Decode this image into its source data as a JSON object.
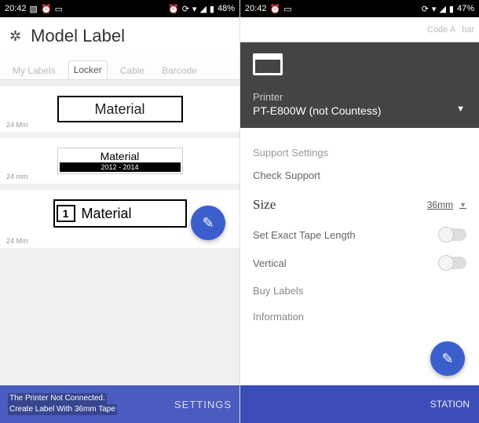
{
  "status": {
    "time": "20:42",
    "battery_left": "48%",
    "battery_right": "47%"
  },
  "screen1": {
    "title": "Model Label",
    "tabs": {
      "my_labels": "My Labels",
      "locker": "Locker",
      "cable": "Cable",
      "barcode": "Barcode"
    },
    "labels": {
      "l1": {
        "text": "Material",
        "size": "24 Mm"
      },
      "l2": {
        "title": "Material",
        "sub": "2012 - 2014",
        "size": "24 mm"
      },
      "l3": {
        "num": "1",
        "text": "Material",
        "size": "24 Mm"
      }
    },
    "footer": {
      "msg1": "The Printer Not Connected.",
      "msg2": "Create Label With 36mm Tape",
      "settings": "SETTINGS"
    }
  },
  "screen2": {
    "tabs_peek": {
      "code": "Code A",
      "bar": "bar"
    },
    "printer": {
      "label": "Printer",
      "name": "PT-E800W (not Countess)"
    },
    "support_settings": "Support Settings",
    "check_support": "Check Support",
    "size_label": "Size",
    "size_value": "36mm",
    "exact_tape": "Set Exact Tape Length",
    "vertical": "Vertical",
    "buy_labels": "Buy Labels",
    "information": "Information",
    "footer": {
      "station": "STATION"
    }
  }
}
